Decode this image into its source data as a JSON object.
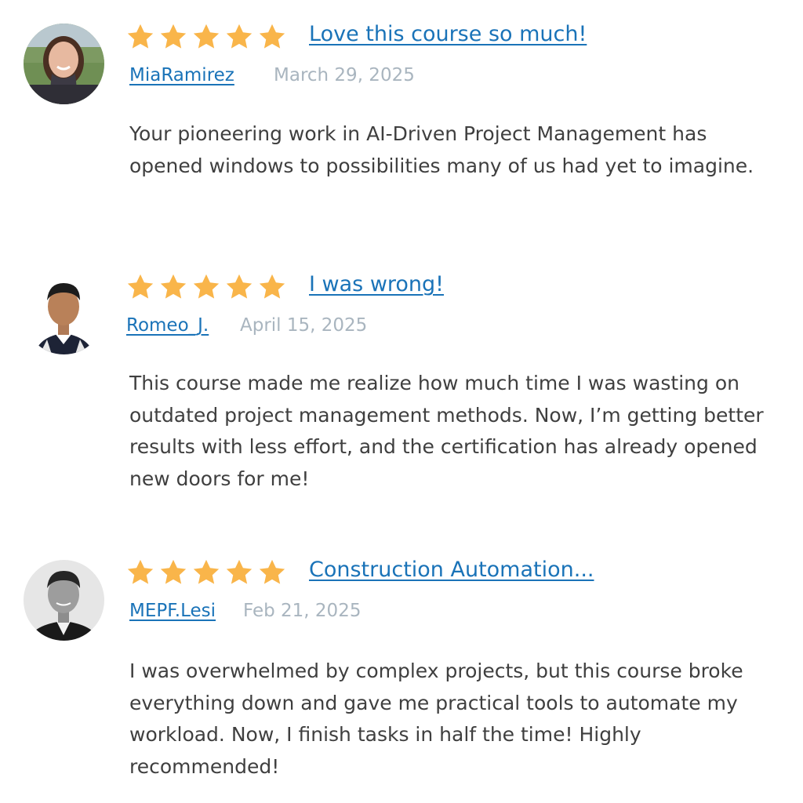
{
  "colors": {
    "star": "#F9B54A",
    "link": "#1A73B8",
    "date": "#A9B5BF",
    "text": "#3F3F3F"
  },
  "reviews": [
    {
      "rating": 5,
      "title": "Love this course so much!",
      "author": "MiaRamirez",
      "date": "March 29, 2025",
      "body": "Your pioneering work in AI-Driven Project Management has opened windows to possibilities many of us had yet to imagine."
    },
    {
      "rating": 5,
      "title": "I was wrong!",
      "author": "Romeo_J.",
      "date": "April 15, 2025",
      "body": "This course made me realize how much time I was wasting on outdated project management methods. Now, I’m getting better results with less effort, and the certification has already opened new doors for me!"
    },
    {
      "rating": 5,
      "title": "Construction Automation...",
      "author": "MEPF.Lesi",
      "date": "Feb 21, 2025",
      "body": "I was overwhelmed by complex projects, but this course broke everything down and gave me practical tools to automate my workload. Now, I finish tasks in half the time! Highly recommended!"
    }
  ]
}
